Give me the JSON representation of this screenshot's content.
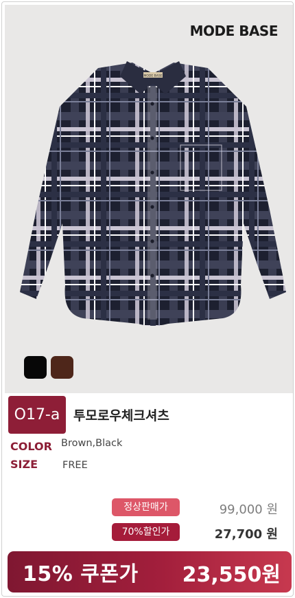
{
  "brand": {
    "logo_text": "MODE BASE",
    "label_text": "MODE BASE"
  },
  "product": {
    "code": "O17-a",
    "name": "투모로우체크셔츠",
    "color_label": "COLOR",
    "color_value": "Brown,Black",
    "size_label": "SIZE",
    "size_value": "FREE",
    "swatches": [
      {
        "name": "black",
        "color": "#070707"
      },
      {
        "name": "brown",
        "color": "#4e261a"
      }
    ]
  },
  "pricing": {
    "regular_label": "정상판매가",
    "regular_price": "99,000 원",
    "sale_label": "70%할인가",
    "sale_price": "27,700 원",
    "coupon_label": "15% 쿠폰가",
    "coupon_price": "23,550원"
  },
  "colors": {
    "accent": "#8e1e37",
    "regular_tag": "#dd5768",
    "sale_tag": "#a51c3a",
    "shirt_base": "#1d2030"
  }
}
